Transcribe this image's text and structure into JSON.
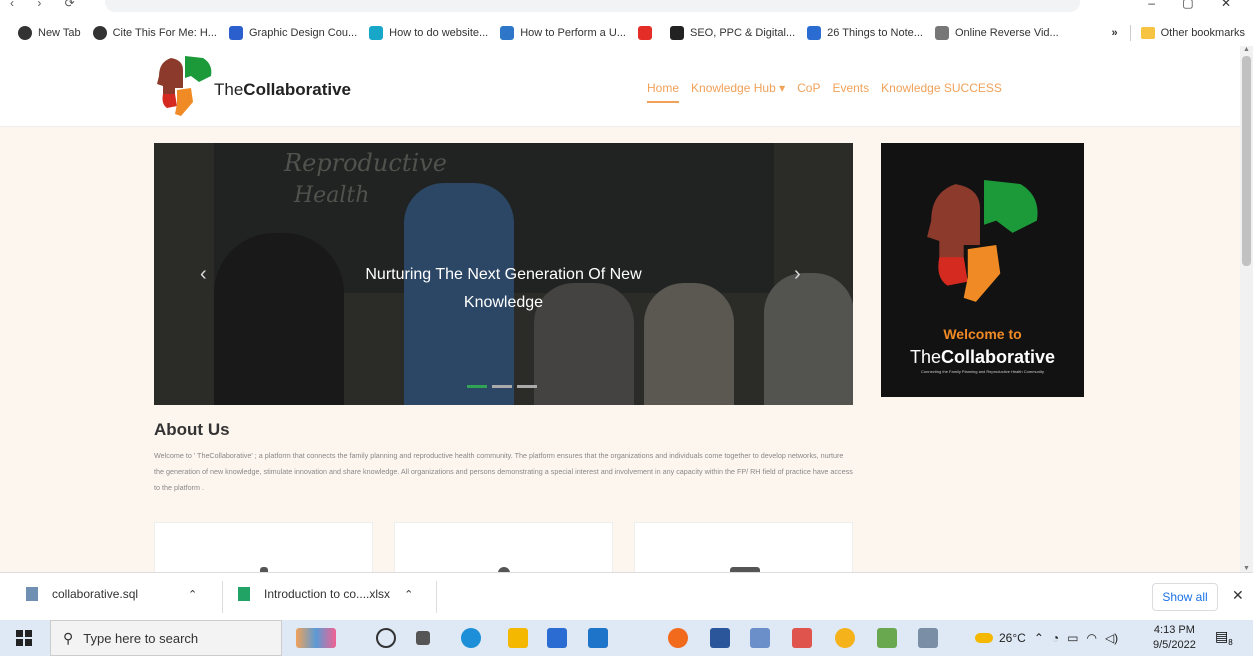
{
  "bookmarks": [
    {
      "label": "New Tab",
      "color": "#333333"
    },
    {
      "label": "Cite This For Me: H...",
      "color": "#333333"
    },
    {
      "label": "Graphic Design Cou...",
      "color": "#2b5fce"
    },
    {
      "label": "How to do website...",
      "color": "#19a7c9"
    },
    {
      "label": "How to Perform a U...",
      "color": "#2e77c8"
    },
    {
      "label": "",
      "color": "#e52d27"
    },
    {
      "label": "SEO, PPC & Digital...",
      "color": "#222222"
    },
    {
      "label": "26 Things to Note...",
      "color": "#2b6cd2"
    },
    {
      "label": "Online Reverse Vid...",
      "color": "#777777"
    }
  ],
  "bookmarks_overflow": "»",
  "other_bookmarks": "Other bookmarks",
  "site": {
    "logo_text_prefix": "The",
    "logo_text_bold": "Collaborative",
    "menu": [
      "Home",
      "Knowledge Hub ▾",
      "CoP",
      "Events",
      "Knowledge SUCCESS"
    ],
    "accent_color": "#f0a15a"
  },
  "hero": {
    "chalk_line1": "Reproductive",
    "chalk_line2": "Health",
    "caption_line1": "Nurturing The Next Generation Of New",
    "caption_line2": "Knowledge",
    "prev": "‹",
    "next": "›",
    "slide_count": 3,
    "active_slide": 1
  },
  "welcome": {
    "line1": "Welcome to",
    "line2_prefix": "The",
    "line2_bold": "Collaborative",
    "tagline": "Connecting the Family Planning and Reproductive Health Community"
  },
  "about": {
    "heading": "About Us",
    "text": "Welcome to ' TheCollaborative' ; a platform that connects the family planning and reproductive health community. The platform ensures that the organizations and individuals come together to develop networks, nurture the generation of new knowledge, stimulate innovation and share knowledge. All organizations and persons demonstrating a special interest and involvement in any capacity within the FP/ RH field of practice have access to the platform ."
  },
  "downloads": {
    "items": [
      {
        "name": "collaborative.sql"
      },
      {
        "name": "Introduction to co....xlsx"
      }
    ],
    "show_all": "Show all",
    "close": "✕"
  },
  "taskbar": {
    "search_placeholder": "Type here to search",
    "temperature": "26°C",
    "time": "4:13 PM",
    "date": "9/5/2022",
    "notification_count": "8"
  }
}
